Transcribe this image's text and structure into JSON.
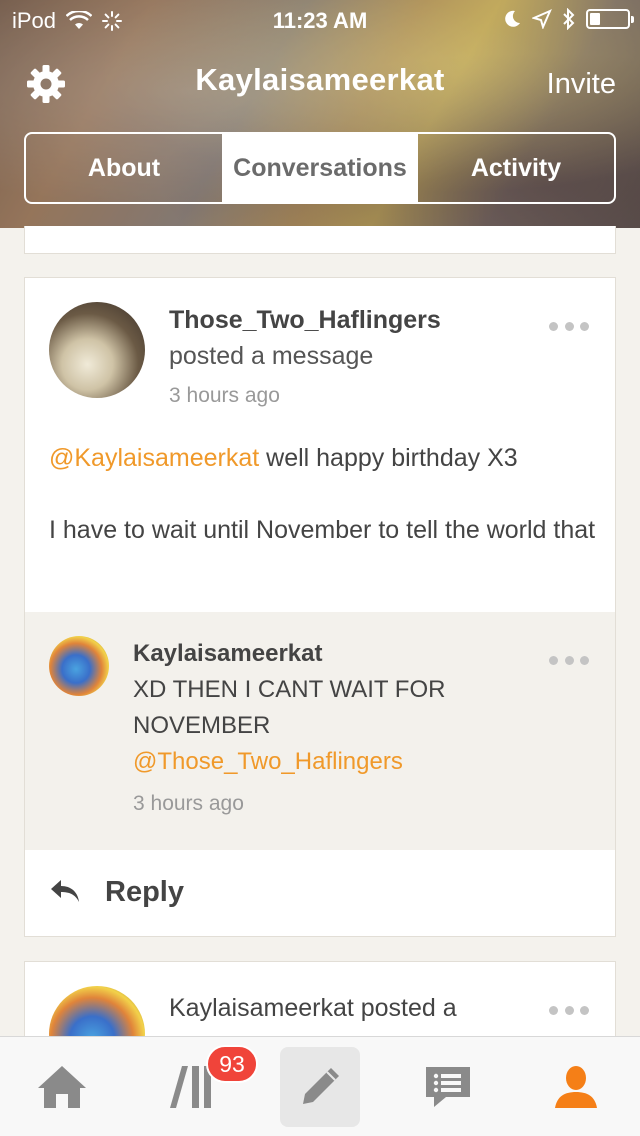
{
  "status_bar": {
    "carrier": "iPod",
    "time": "11:23 AM"
  },
  "nav": {
    "title": "Kaylaisameerkat",
    "invite_label": "Invite"
  },
  "segments": [
    {
      "label": "About",
      "active": false
    },
    {
      "label": "Conversations",
      "active": true
    },
    {
      "label": "Activity",
      "active": false
    }
  ],
  "post": {
    "author": "Those_Two_Haflingers",
    "action": "posted a message",
    "time": "3 hours ago",
    "mention": "@Kaylaisameerkat",
    "text_line1": " well happy birthday X3",
    "text_para2": "I have to wait until November to tell the world that",
    "reply": {
      "author": "Kaylaisameerkat",
      "text": "XD THEN I CANT WAIT FOR NOVEMBER",
      "mention": "@Those_Two_Haflingers",
      "time": "3 hours ago"
    },
    "reply_label": "Reply"
  },
  "next_post": {
    "text": "Kaylaisameerkat posted a message"
  },
  "tabbar": {
    "badge_count": "93",
    "accent_color": "#f57f17"
  },
  "colors": {
    "mention": "#f0992a",
    "badge": "#f0443a"
  }
}
